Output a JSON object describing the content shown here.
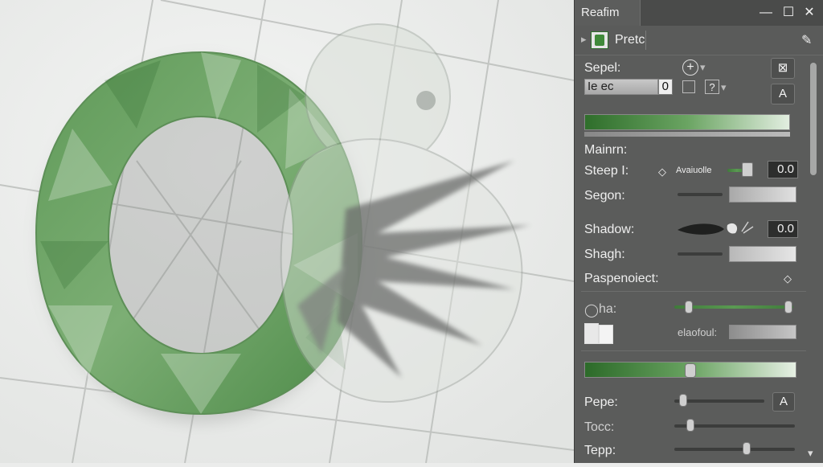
{
  "window": {
    "tab_label": "Reafim"
  },
  "toolbar": {
    "preset_label": "Pretc"
  },
  "props": {
    "sepel_label": "Sepel:",
    "leec_label": "Ie ec",
    "leec_value": "0",
    "maint_label": "Mainrn:",
    "step_label": "Steep I:",
    "step_sub": "Avaiuolle",
    "step_value": "0.0",
    "segon_label": "Segon:",
    "shadow_label": "Shadow:",
    "shadow_value": "0.0",
    "shagh_label": "Shagh:",
    "perspective_label": "Paspenoiect:",
    "opacity_label": "ha:",
    "placeholder_label": "elaofoul:",
    "pepe_label": "Pepe:",
    "toc_label": "Tocc:",
    "tepp_label": "Tepp:"
  },
  "sliders": {
    "opacity_left": 0.12,
    "opacity_right": 0.96,
    "gradient_pos": 0.5,
    "pepe": 0.1,
    "toc": 0.13,
    "tepp": 0.6
  },
  "colors": {
    "accent_green": "#3f7a3a",
    "light_green": "#d9ead7"
  }
}
